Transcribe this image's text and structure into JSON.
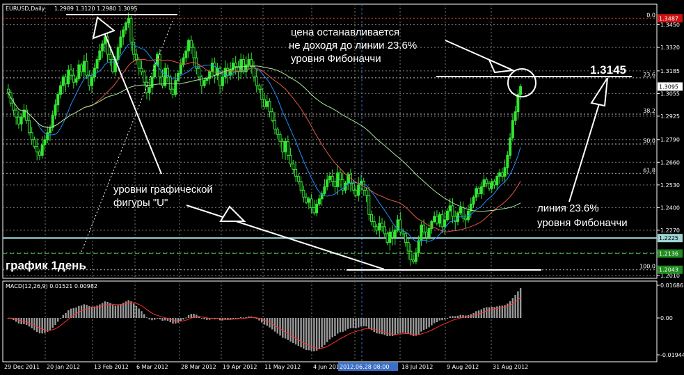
{
  "header": {
    "symbol_label": "EURUSD,Daily",
    "ohlc": "1.2989 1.3120 1.2980 1.3095"
  },
  "macd": {
    "label": "MACD(12,26,9) 0.01521 0.00982",
    "axis_labels": [
      "0.01686",
      "0.00",
      "-0.01944"
    ]
  },
  "annotations": {
    "top_note": [
      "цена останавливается",
      "не доходя до линии 23.6%",
      "уровня Фибоначчи"
    ],
    "u_note": [
      "уровни графической",
      "фигуры \"U\""
    ],
    "price_callout": "1.3145",
    "fib_note": [
      "линия 23.6%",
      "уровня Фибоначчи"
    ],
    "timeframe_note": "график 1день"
  },
  "fib_levels": [
    {
      "label": "0.0",
      "price": 1.3487
    },
    {
      "label": "23.6",
      "price": 1.3145
    },
    {
      "label": "38.2",
      "price": 1.2937
    },
    {
      "label": "50.0",
      "price": 1.2765
    },
    {
      "label": "61.8",
      "price": 1.2596
    },
    {
      "label": "100.0",
      "price": 1.2043
    }
  ],
  "price_tags": [
    {
      "text": "1.3487",
      "price": 1.3487,
      "bg": "#cc1111",
      "fg": "#ffffff"
    },
    {
      "text": "1.3095",
      "price": 1.3095,
      "bg": "#ffffff",
      "fg": "#000000"
    },
    {
      "text": "1.2225",
      "price": 1.2225,
      "bg": "#9fd4d4",
      "fg": "#000000"
    },
    {
      "text": "1.2136",
      "price": 1.2136,
      "bg": "#1e8c1e",
      "fg": "#ffffff"
    },
    {
      "text": "1.2043",
      "price": 1.2043,
      "bg": "#1e8c1e",
      "fg": "#ffffff"
    }
  ],
  "x_axis": {
    "labels": [
      "29 Dec 2011",
      "20 Jan 2012",
      "13 Feb 2012",
      "6 Mar 2012",
      "28 Mar 2012",
      "19 Apr 2012",
      "11 May 2012",
      "4 Jun 2012",
      "2012.06.28 08:00",
      "18 Jul 2012",
      "9 Aug 2012",
      "31 Aug 2012"
    ],
    "highlight_index": 8
  },
  "chart_data": {
    "type": "candlestick",
    "title": "EURUSD,Daily",
    "y_ticks": [
      1.345,
      1.332,
      1.3185,
      1.3055,
      1.2925,
      1.279,
      1.266,
      1.253,
      1.24,
      1.227,
      1.214,
      1.201
    ],
    "ylim": [
      1.201,
      1.356
    ],
    "candle_closes": [
      1.306,
      1.3,
      1.296,
      1.292,
      1.288,
      1.292,
      1.296,
      1.29,
      1.283,
      1.279,
      1.275,
      1.272,
      1.27,
      1.276,
      1.279,
      1.283,
      1.286,
      1.293,
      1.299,
      1.305,
      1.31,
      1.315,
      1.311,
      1.319,
      1.316,
      1.312,
      1.314,
      1.322,
      1.318,
      1.324,
      1.316,
      1.31,
      1.315,
      1.32,
      1.325,
      1.33,
      1.334,
      1.338,
      1.328,
      1.325,
      1.318,
      1.325,
      1.332,
      1.338,
      1.342,
      1.346,
      1.3487,
      1.335,
      1.328,
      1.325,
      1.32,
      1.318,
      1.312,
      1.306,
      1.309,
      1.315,
      1.322,
      1.328,
      1.315,
      1.31,
      1.32,
      1.315,
      1.308,
      1.305,
      1.313,
      1.317,
      1.322,
      1.326,
      1.33,
      1.336,
      1.332,
      1.326,
      1.32,
      1.315,
      1.31,
      1.313,
      1.314,
      1.318,
      1.323,
      1.316,
      1.32,
      1.31,
      1.315,
      1.32,
      1.316,
      1.319,
      1.323,
      1.321,
      1.318,
      1.325,
      1.318,
      1.322,
      1.325,
      1.321,
      1.315,
      1.31,
      1.308,
      1.302,
      1.298,
      1.301,
      1.295,
      1.29,
      1.285,
      1.282,
      1.278,
      1.272,
      1.278,
      1.27,
      1.265,
      1.262,
      1.258,
      1.255,
      1.25,
      1.246,
      1.243,
      1.245,
      1.24,
      1.237,
      1.242,
      1.245,
      1.248,
      1.252,
      1.256,
      1.258,
      1.255,
      1.252,
      1.26,
      1.256,
      1.25,
      1.254,
      1.259,
      1.254,
      1.25,
      1.247,
      1.253,
      1.255,
      1.25,
      1.247,
      1.236,
      1.232,
      1.229,
      1.227,
      1.231,
      1.229,
      1.225,
      1.22,
      1.226,
      1.223,
      1.227,
      1.233,
      1.226,
      1.225,
      1.22,
      1.215,
      1.21,
      1.209,
      1.214,
      1.221,
      1.23,
      1.226,
      1.223,
      1.228,
      1.232,
      1.235,
      1.231,
      1.236,
      1.229,
      1.233,
      1.238,
      1.241,
      1.235,
      1.232,
      1.237,
      1.24,
      1.234,
      1.233,
      1.238,
      1.242,
      1.246,
      1.251,
      1.248,
      1.252,
      1.256,
      1.254,
      1.251,
      1.255,
      1.253,
      1.258,
      1.26,
      1.258,
      1.263,
      1.27,
      1.28,
      1.29,
      1.295,
      1.305,
      1.3095
    ]
  },
  "colors": {
    "candles": "#32e632",
    "ma_fast": "#1e90ff",
    "ma_mid": "#e05a40",
    "ma_slow": "#a8e89a",
    "macd_hist": "#9a9a9a",
    "macd_signal": "#ff3030",
    "grid": "#7a7a7a"
  }
}
